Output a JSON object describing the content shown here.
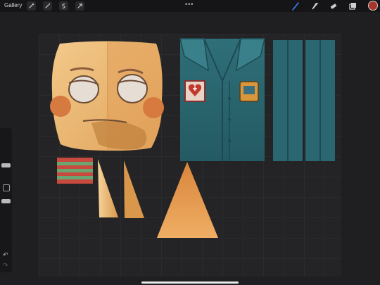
{
  "toolbar": {
    "gallery_label": "Gallery",
    "more_label": "•••",
    "left_tools": [
      "wrench-icon",
      "magic-wand-icon",
      "selection-icon",
      "transform-arrow-icon"
    ],
    "right_tools": [
      "brush-icon",
      "smudge-icon",
      "eraser-icon",
      "layers-icon"
    ],
    "active_color": "#a8342a",
    "active_tool_color": "#3b82f6"
  },
  "sidebar": {
    "undo_label": "↶",
    "redo_label": "↷"
  },
  "canvas": {
    "background": "#242426",
    "grid": true,
    "pieces": [
      "face-texture",
      "shirt-front-texture",
      "sleeve-texture-left",
      "sleeve-texture-right",
      "striped-swatch",
      "ear-triangle-left",
      "ear-triangle-right",
      "nose-triangle"
    ]
  }
}
